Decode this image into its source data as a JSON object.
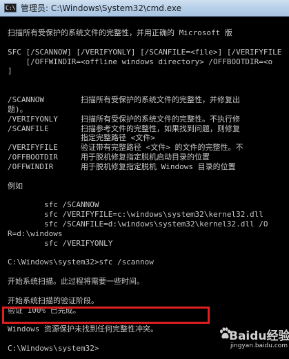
{
  "window": {
    "title": "管理员: C:\\Windows\\System32\\cmd.exe",
    "icon_name": "cmd-console-icon",
    "icon_text": "C:\\"
  },
  "console": {
    "lines": [
      "扫描所有受保护的系统文件的完整性，并用正确的 Microsoft 版",
      "",
      "SFC [/SCANNOW] [/VERIFYONLY] [/SCANFILE=<file>] [/VERIFYFILE",
      "    [/OFFWINDIR=<offline windows directory> /OFFBOOTDIR=<o",
      "]",
      "",
      "",
      "/SCANNOW        扫描所有受保护的系统文件的完整性，并修复出",
      "题)。",
      "/VERIFYONLY     扫描所有受保护的系统文件的完整性。不执行修",
      "/SCANFILE       扫描参考文件的完整性，如果找到问题，则修复",
      "                指定完整路径 <文件>",
      "/VERIFYFILE     验证带有完整路径 <文件> 的文件的完整性。不",
      "/OFFBOOTDIR     用于脱机修复指定脱机启动目录的位置",
      "/OFFWINDIR      用于脱机修复指定脱机 Windows 目录的位置",
      "",
      "例如",
      "",
      "        sfc /SCANNOW",
      "        sfc /VERIFYFILE=c:\\windows\\system32\\kernel32.dll",
      "        sfc /SCANFILE=d:\\windows\\system32\\kernel32.dll /O",
      "R=d:\\windows",
      "        sfc /VERIFYONLY",
      "",
      "C:\\Windows\\system32>sfc /scannow",
      "",
      "开始系统扫描。此过程将需要一些时间。",
      "",
      "开始系统扫描的验证阶段。",
      "验证 100% 已完成。",
      "",
      "Windows 资源保护未找到任何完整性冲突。",
      "",
      "C:\\Windows\\system32>"
    ]
  },
  "watermark": {
    "brand": "Baidu经验",
    "url": "jingyan.baidu.com",
    "icon_name": "baidu-paw-icon"
  },
  "colors": {
    "console_background": "#000000",
    "console_text": "#c8c8c8",
    "highlight_border": "#e02020",
    "titlebar": "#b9d1ea"
  }
}
